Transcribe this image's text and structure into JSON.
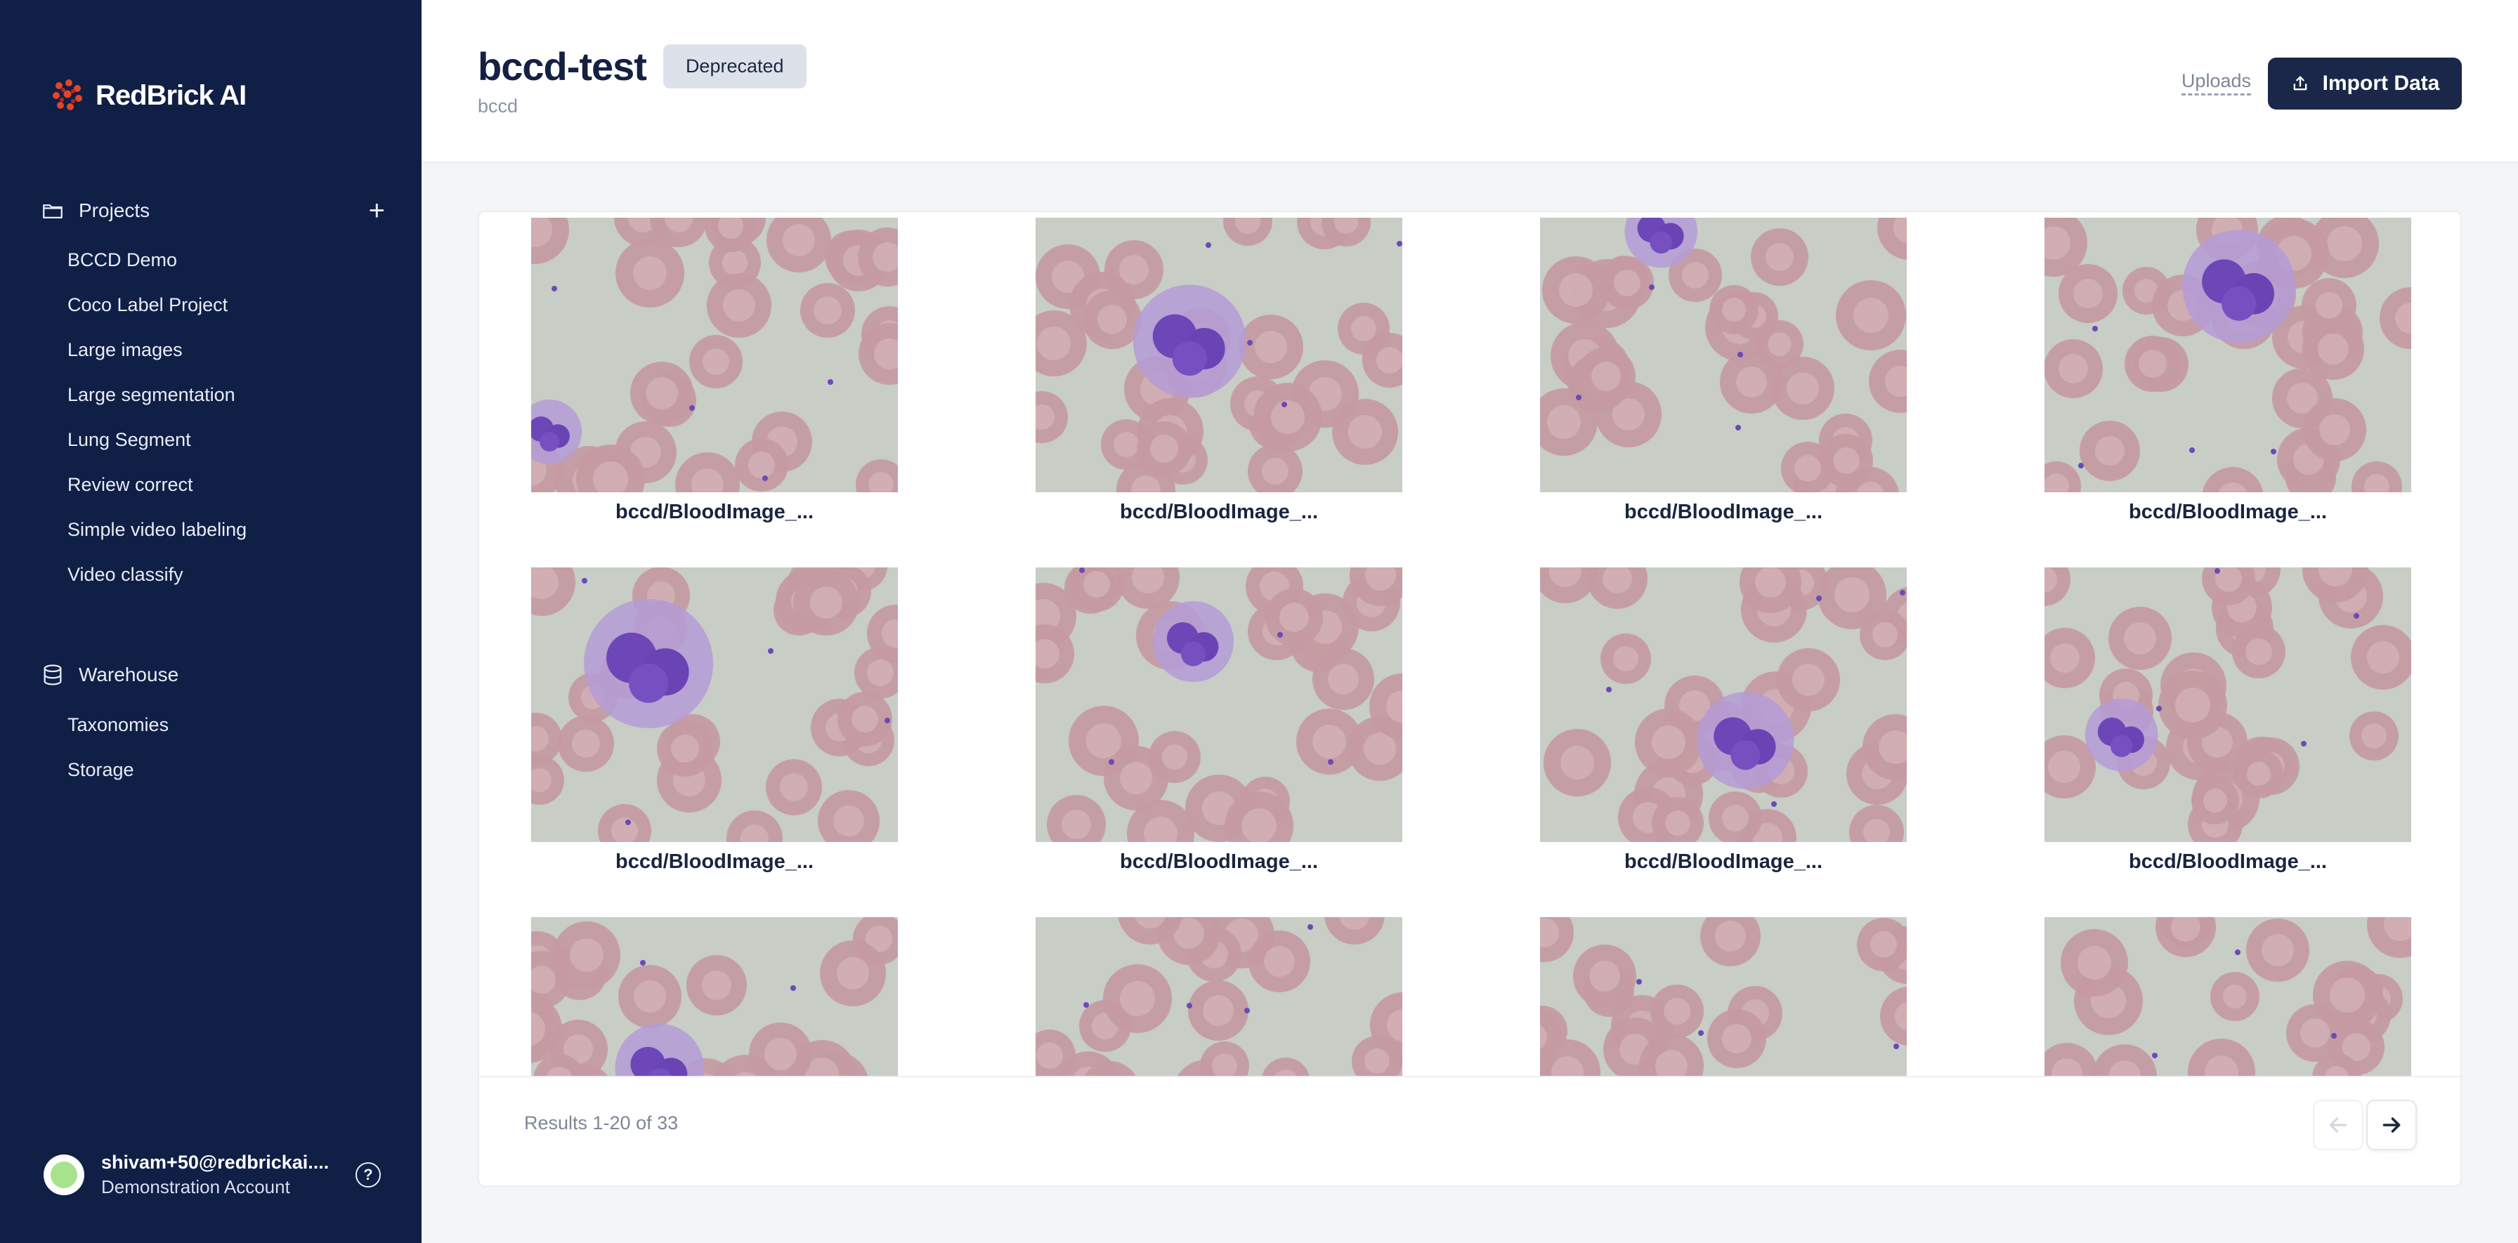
{
  "sidebar": {
    "brand": "RedBrick AI",
    "projects_label": "Projects",
    "projects": [
      "BCCD Demo",
      "Coco Label Project",
      "Large images",
      "Large segmentation",
      "Lung Segment",
      "Review correct",
      "Simple video labeling",
      "Video classify"
    ],
    "warehouse_label": "Warehouse",
    "warehouse_items": [
      "Taxonomies",
      "Storage"
    ],
    "user_email": "shivam+50@redbrickai....",
    "user_role": "Demonstration Account"
  },
  "header": {
    "title": "bccd-test",
    "badge": "Deprecated",
    "subtitle": "bccd",
    "uploads_link": "Uploads",
    "import_button": "Import Data"
  },
  "gallery": {
    "items": [
      "bccd/BloodImage_...",
      "bccd/BloodImage_...",
      "bccd/BloodImage_...",
      "bccd/BloodImage_...",
      "bccd/BloodImage_...",
      "bccd/BloodImage_...",
      "bccd/BloodImage_...",
      "bccd/BloodImage_..."
    ]
  },
  "footer": {
    "results": "Results 1-20 of 33"
  },
  "colors": {
    "sidebar_bg": "#0f1f46",
    "accent_button": "#1a2748",
    "badge_bg": "#dde2ea",
    "logo_red": "#e3452a"
  }
}
